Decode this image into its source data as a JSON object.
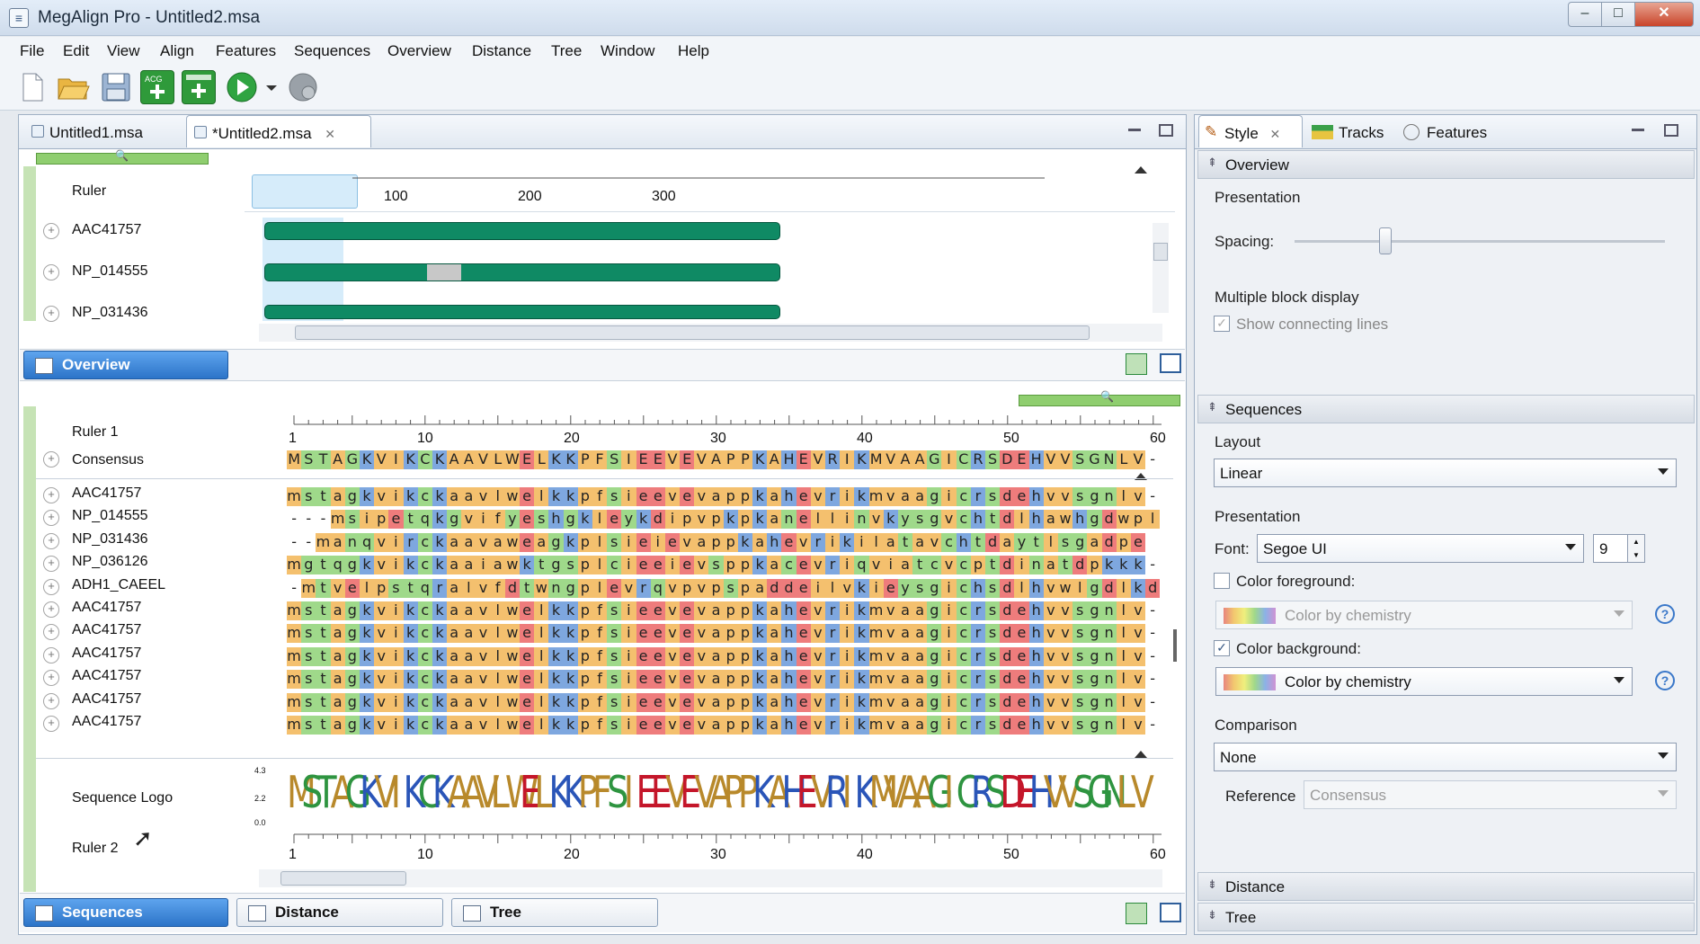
{
  "window": {
    "title": "MegAlign Pro - Untitled2.msa",
    "min": "–",
    "max": "□",
    "close": "✕"
  },
  "menu": [
    "File",
    "Edit",
    "View",
    "Align",
    "Features",
    "Sequences",
    "Overview",
    "Distance",
    "Tree",
    "Window",
    "Help"
  ],
  "editor_tabs": [
    {
      "label": "Untitled1.msa"
    },
    {
      "label": "*Untitled2.msa",
      "close": "✕"
    }
  ],
  "overview": {
    "ruler_label": "Ruler",
    "ticks": [
      "100",
      "200",
      "300"
    ],
    "rows": [
      "AAC41757",
      "NP_014555",
      "NP_031436"
    ],
    "tab_label": "Overview"
  },
  "sequences": {
    "ruler1_label": "Ruler 1",
    "consensus_label": "Consensus",
    "ticks": [
      "1",
      "10",
      "20",
      "30",
      "40",
      "50",
      "60"
    ],
    "consensus": "MSTAGKVIKCKAAVLWELKKPFSIEEVEVAPPKAHEVRIKMVAAGICRSDEHVVSGNLV-",
    "names": [
      "AAC41757",
      "NP_014555",
      "NP_031436",
      "NP_036126",
      "ADH1_CAEEL",
      "AAC41757",
      "AAC41757",
      "AAC41757",
      "AAC41757",
      "AAC41757",
      "AAC41757"
    ],
    "rows": [
      "mstagkvikckaavlwelkkpfsieevevappkahevrikmvaagicrsdehvvsgnlv-",
      "---msipetqkgvifyeshgkleykdipvpkpkanellinvkysgvchtdlhawhgdwpl",
      "--manqvirckaavaweagkplsieievappkahevrikilatavchtdaytlsgadpe",
      "mgtqgkvikckaaiawktgsplcieeievsppkacevriqviatcvcptdinatdpkkk-",
      "-mtvelpstqralvfdtwngplevrqvpvpspaddeilvkieysgichsdlhvwlgdlkd",
      "mstagkvikckaavlwelkkpfsieevevappkahevrikmvaagicrsdehvvsgnlv-",
      "mstagkvikckaavlwelkkpfsieevevappkahevrikmvaagicrsdehvvsgnlv-",
      "mstagkvikckaavlwelkkpfsieevevappkahevrikmvaagicrsdehvvsgnlv-",
      "mstagkvikckaavlwelkkpfsieevevappkahevrikmvaagicrsdehvvsgnlv-",
      "mstagkvikckaavlwelkkpfsieevevappkahevrikmvaagicrsdehvvsgnlv-",
      "mstagkvikckaavlwelkkpfsieevevappkahevrikmvaagicrsdehvvsgnlv-"
    ],
    "logo_label": "Sequence Logo",
    "logo_axis": [
      "4.3",
      "2.2",
      "0.0"
    ],
    "ruler2_label": "Ruler 2"
  },
  "bottom_tabs": [
    {
      "label": "Sequences"
    },
    {
      "label": "Distance"
    },
    {
      "label": "Tree"
    }
  ],
  "side_tabs": [
    {
      "label": "Style",
      "close": "✕"
    },
    {
      "label": "Tracks"
    },
    {
      "label": "Features"
    }
  ],
  "style_panel": {
    "overview_section": "Overview",
    "presentation": "Presentation",
    "spacing": "Spacing:",
    "multiple_block": "Multiple block display",
    "show_lines": "Show connecting lines",
    "sequences_section": "Sequences",
    "layout": "Layout",
    "layout_value": "Linear",
    "presentation2": "Presentation",
    "font_label": "Font:",
    "font_value": "Segoe UI",
    "font_size": "9",
    "color_fg": "Color foreground:",
    "color_fg_value": "Color by chemistry",
    "color_bg": "Color background:",
    "color_bg_value": "Color by chemistry",
    "comparison": "Comparison",
    "comparison_value": "None",
    "reference_label": "Reference",
    "reference_value": "Consensus",
    "distance_section": "Distance",
    "tree_section": "Tree",
    "help": "?"
  },
  "residue_colors": {
    "hydrophobic": "#f4c06e",
    "polar": "#9fd98a",
    "positive": "#7ea7df",
    "negative": "#ee7c7c",
    "special": "#f4c06e",
    "gap": "#ffffff"
  },
  "accent": "#1f6fc9"
}
